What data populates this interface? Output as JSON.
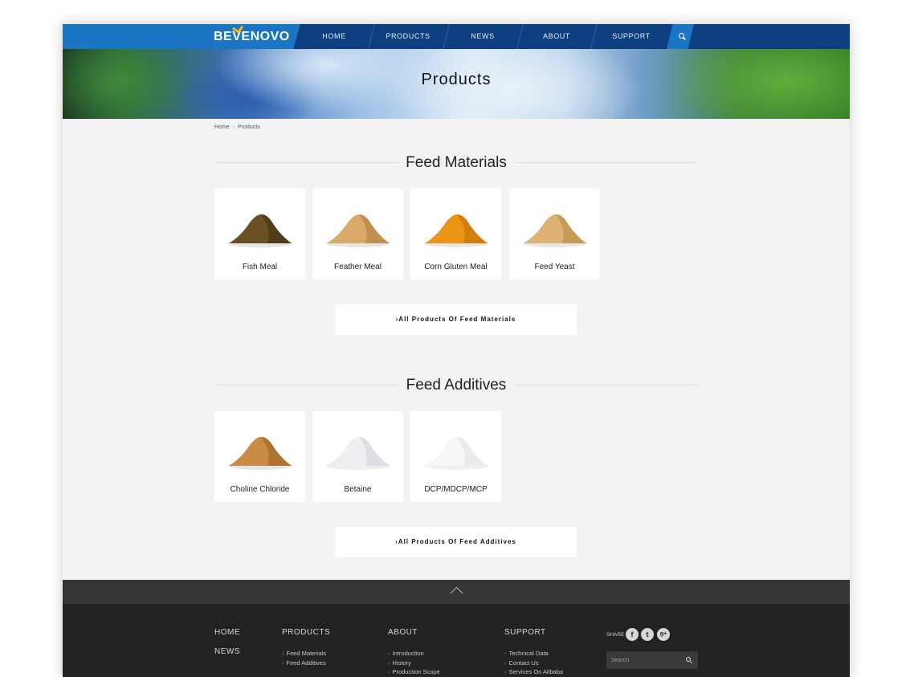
{
  "brand": {
    "logo_pre": "BE",
    "logo_v": "V",
    "logo_post": "ENOVO",
    "accent": "#1a76c4",
    "nav_bg": "#0d3f80",
    "tick_color": "#f2b81c"
  },
  "nav": {
    "items": [
      "HOME",
      "PRODUCTS",
      "NEWS",
      "ABOUT",
      "SUPPORT"
    ],
    "search_icon": "search-icon"
  },
  "banner": {
    "title": "Products"
  },
  "breadcrumb": {
    "home": "Home",
    "separator": "›",
    "current": "Products"
  },
  "sections": [
    {
      "title": "Feed Materials",
      "products": [
        {
          "name": "Fish Meal",
          "color": "#6b5023",
          "shade": "#3f2e12"
        },
        {
          "name": "Feather Meal",
          "color": "#d9aa6a",
          "shade": "#b07e40"
        },
        {
          "name": "Corn Gluten Meal",
          "color": "#ec9414",
          "shade": "#c76f06"
        },
        {
          "name": "Feed Yeast",
          "color": "#ddb273",
          "shade": "#b98a46"
        }
      ],
      "all_label": "›All Products Of Feed Materials"
    },
    {
      "title": "Feed Additives",
      "products": [
        {
          "name": "Choline Chloride",
          "color": "#c98c45",
          "shade": "#9b6424"
        },
        {
          "name": "Betaine",
          "color": "#f1eef3",
          "shade": "#d6cfdc"
        },
        {
          "name": "DCP/MDCP/MCP",
          "color": "#f7f7f7",
          "shade": "#e2e2e2"
        }
      ],
      "all_label": "›All Products Of Feed Additives"
    }
  ],
  "footer": {
    "home": "HOME",
    "news": "NEWS",
    "products": {
      "title": "PRODUCTS",
      "links": [
        "Feed Materials",
        "Feed Additives"
      ]
    },
    "about": {
      "title": "ABOUT",
      "links": [
        "Introduction",
        "History",
        "Production Scope"
      ]
    },
    "support": {
      "title": "SUPPORT",
      "links": [
        "Technical Data",
        "Contact Us",
        "Services On Alibaba"
      ]
    },
    "share_label": "SHARE :",
    "social": [
      {
        "icon": "facebook-icon",
        "glyph": "f"
      },
      {
        "icon": "twitter-icon",
        "glyph": "t"
      },
      {
        "icon": "google-plus-icon",
        "glyph": "g+"
      }
    ],
    "search_placeholder": "Search",
    "link_arrow": "›",
    "up_icon": "chevron-up-icon"
  }
}
